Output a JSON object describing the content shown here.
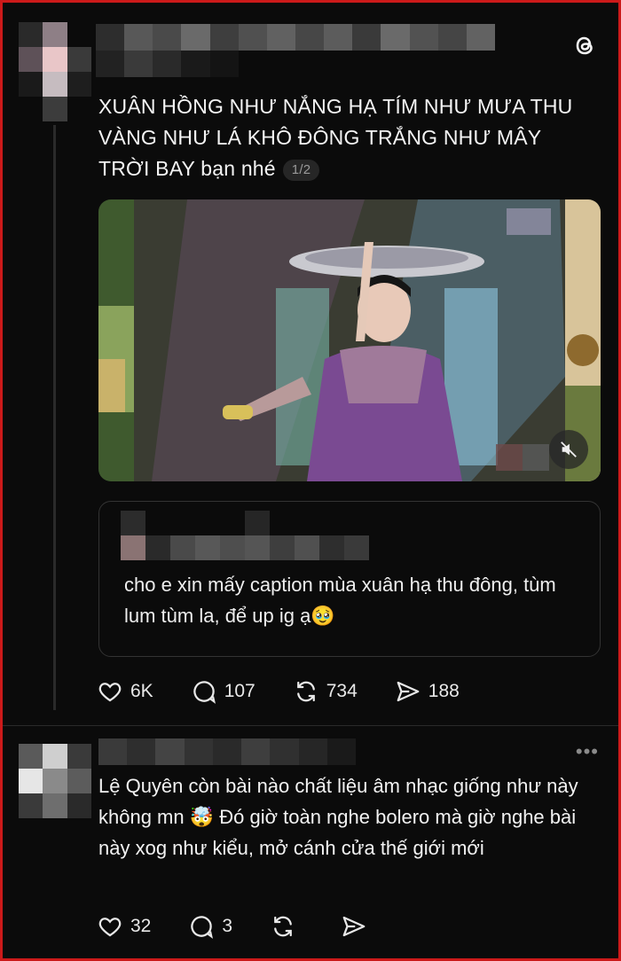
{
  "post": {
    "caption": "XUÂN HỒNG NHƯ NẮNG HẠ TÍM NHƯ MƯA THU VÀNG NHƯ LÁ KHÔ ĐÔNG TRẮNG NHƯ MÂY TRỜI BAY bạn nhé",
    "media_counter": "1/2",
    "logo_icon": "threads-logo-icon",
    "video_muted": true,
    "quoted_post": {
      "text": "cho e xin mấy caption mùa xuân hạ thu đông, tùm lum tùm la, để up ig ạ🥹"
    },
    "actions": {
      "likes": "6K",
      "replies": "107",
      "reposts": "734",
      "shares": "188"
    }
  },
  "reply": {
    "text": "Lệ Quyên còn bài nào chất liệu âm nhạc giống như này không mn 🤯 Đó giờ toàn nghe bolero mà giờ nghe bài này xog như kiểu, mở cánh cửa thế giới mới",
    "more_icon": "more-dots-icon",
    "actions": {
      "likes": "32",
      "replies": "3"
    }
  },
  "colors": {
    "background": "#0b0b0b",
    "frame_border": "#cc1a1a",
    "text": "#f3f3f3",
    "muted": "#9a9a9a"
  }
}
